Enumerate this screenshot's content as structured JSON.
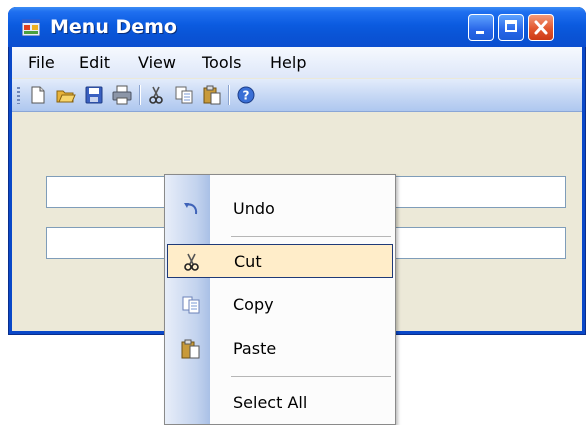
{
  "window": {
    "title": "Menu Demo"
  },
  "menubar": {
    "items": [
      "File",
      "Edit",
      "View",
      "Tools",
      "Help"
    ]
  },
  "toolbar": {
    "icons": [
      "new-file-icon",
      "open-folder-icon",
      "save-icon",
      "print-icon",
      "cut-icon",
      "copy-icon",
      "paste-icon",
      "help-icon"
    ]
  },
  "context_menu": {
    "items": [
      {
        "label": "Undo",
        "icon": "undo-icon"
      },
      {
        "label": "Cut",
        "icon": "scissors-icon",
        "highlighted": true
      },
      {
        "label": "Copy",
        "icon": "copy-icon"
      },
      {
        "label": "Paste",
        "icon": "paste-icon"
      },
      {
        "label": "Select All",
        "icon": ""
      }
    ]
  },
  "colors": {
    "titlebar": "#0a54d6",
    "menu_highlight": "#ffedc9",
    "menu_highlight_border": "#1f3a78",
    "client_bg": "#ece9d8"
  }
}
